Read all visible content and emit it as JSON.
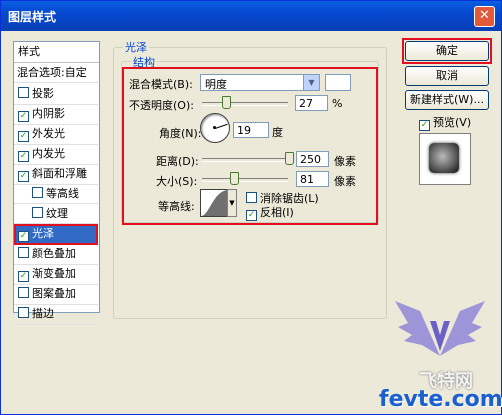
{
  "window": {
    "title": "图层样式",
    "close_glyph": "✕"
  },
  "styles_list": {
    "header": "样式",
    "blend_options": "混合选项:自定",
    "items": [
      {
        "label": "投影",
        "checked": false
      },
      {
        "label": "内阴影",
        "checked": true
      },
      {
        "label": "外发光",
        "checked": true
      },
      {
        "label": "内发光",
        "checked": true
      },
      {
        "label": "斜面和浮雕",
        "checked": true
      },
      {
        "label": "等高线",
        "checked": false
      },
      {
        "label": "纹理",
        "checked": false
      },
      {
        "label": "光泽",
        "checked": true,
        "selected": true
      },
      {
        "label": "颜色叠加",
        "checked": false
      },
      {
        "label": "渐变叠加",
        "checked": true
      },
      {
        "label": "图案叠加",
        "checked": false
      },
      {
        "label": "描边",
        "checked": false
      }
    ]
  },
  "panel": {
    "group_title": "光泽",
    "sub_title": "结构",
    "blend_mode_label": "混合模式(B):",
    "blend_mode_value": "明度",
    "opacity_label": "不透明度(O):",
    "opacity_value": "27",
    "opacity_unit": "%",
    "angle_label": "角度(N):",
    "angle_value": "19",
    "angle_unit": "度",
    "distance_label": "距离(D):",
    "distance_value": "250",
    "distance_unit": "像素",
    "size_label": "大小(S):",
    "size_value": "81",
    "size_unit": "像素",
    "contour_label": "等高线:",
    "antialias_label": "消除锯齿(L)",
    "antialias_checked": false,
    "invert_label": "反相(I)",
    "invert_checked": true
  },
  "buttons": {
    "ok": "确定",
    "cancel": "取消",
    "new_style": "新建样式(W)...",
    "preview_label": "预览(V)",
    "preview_checked": true
  },
  "watermark": {
    "line1": "飞特网",
    "line2": "fevte.com"
  },
  "colors": {
    "accent": "#e01020",
    "titlebar": "#0a5fe0",
    "selection": "#316ac5"
  }
}
